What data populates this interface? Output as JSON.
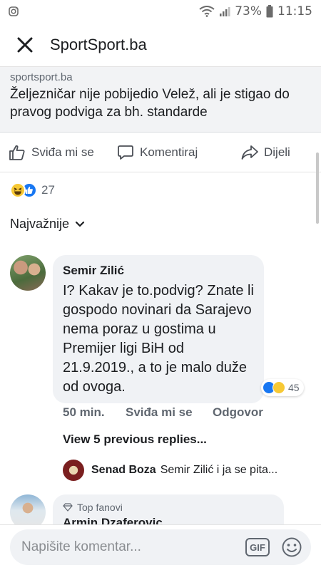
{
  "status_bar": {
    "battery_percent": "73%",
    "time": "11:15",
    "icons": [
      "instagram-icon",
      "wifi-icon",
      "signal-icon",
      "battery-icon"
    ]
  },
  "header": {
    "title": "SportSport.ba",
    "close_icon": "close-icon"
  },
  "link_preview": {
    "domain": "sportsport.ba",
    "title": "Željezničar nije pobijedio Velež, ali je stigao do pravog podviga za bh. standarde"
  },
  "actions": {
    "like_label": "Sviđa mi se",
    "comment_label": "Komentiraj",
    "share_label": "Dijeli"
  },
  "reactions": {
    "types": [
      "haha",
      "like"
    ],
    "count": "27"
  },
  "sort": {
    "label": "Najvažnije"
  },
  "comments": [
    {
      "author": "Semir Zilić",
      "text": "I? Kakav je to.podvig? Znate li gospodo novinari da Sarajevo nema poraz u gostima u Premijer ligi BiH od 21.9.2019., a to je malo duže od ovoga.",
      "reaction_count": "45",
      "time": "50 min.",
      "like_label": "Sviđa mi se",
      "reply_label": "Odgovor",
      "view_replies": "View 5 previous replies...",
      "reply_preview": {
        "author": "Senad Boza",
        "text": "Semir Zilić i ja se pita..."
      }
    },
    {
      "badge": "Top fanovi",
      "author": "Armin Dzaferovic"
    }
  ],
  "comment_input": {
    "placeholder": "Napišite komentar...",
    "gif_label": "GIF"
  },
  "colors": {
    "accent": "#1877f2",
    "haha": "#f7c935",
    "bubble": "#f0f2f5",
    "secondary_text": "#606770"
  }
}
